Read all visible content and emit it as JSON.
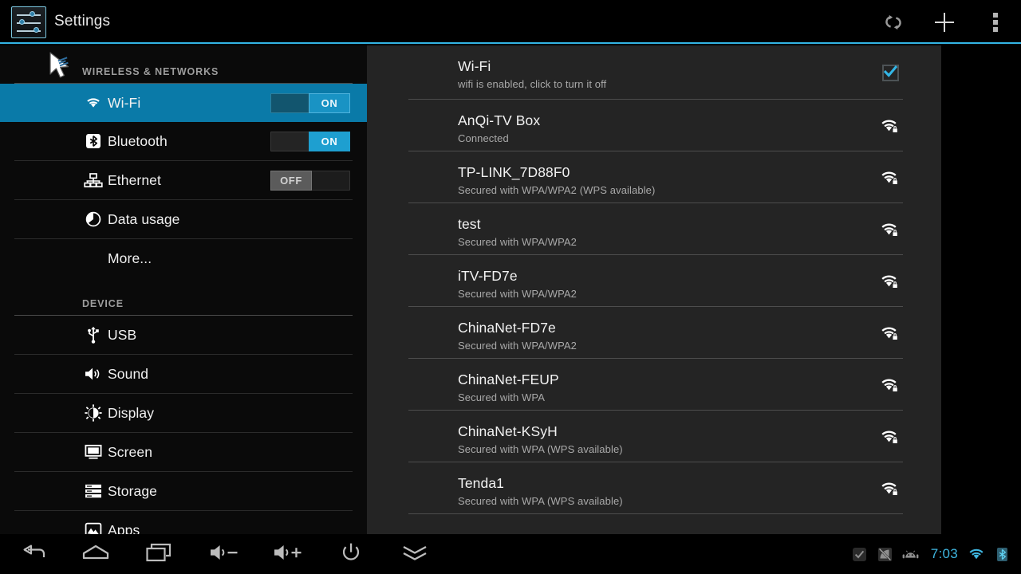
{
  "app": {
    "title": "Settings",
    "icon": "settings-sliders-icon",
    "accent": "#33b5e5",
    "panel_bg": "#242424",
    "sidebar_bg": "#0a0a0a",
    "selected_bg": "#0a7aa8"
  },
  "actionbar": {
    "buttons": [
      {
        "name": "scan-refresh-button",
        "icon": "sync-refresh-icon"
      },
      {
        "name": "add-network-button",
        "icon": "plus-icon"
      },
      {
        "name": "overflow-menu-button",
        "icon": "more-vertical-icon"
      }
    ]
  },
  "sidebar": {
    "groups": [
      {
        "header": "WIRELESS & NETWORKS",
        "items": [
          {
            "label": "Wi-Fi",
            "icon": "wifi-icon",
            "selected": true,
            "toggle": "ON",
            "toggle_state": "on"
          },
          {
            "label": "Bluetooth",
            "icon": "bluetooth-icon",
            "selected": false,
            "toggle": "ON",
            "toggle_state": "on"
          },
          {
            "label": "Ethernet",
            "icon": "ethernet-icon",
            "selected": false,
            "toggle": "OFF",
            "toggle_state": "off"
          },
          {
            "label": "Data usage",
            "icon": "data-usage-icon",
            "selected": false,
            "toggle": null
          },
          {
            "label": "More...",
            "icon": null,
            "selected": false,
            "toggle": null
          }
        ]
      },
      {
        "header": "DEVICE",
        "items": [
          {
            "label": "USB",
            "icon": "usb-icon",
            "selected": false,
            "toggle": null
          },
          {
            "label": "Sound",
            "icon": "sound-icon",
            "selected": false,
            "toggle": null
          },
          {
            "label": "Display",
            "icon": "display-brightness-icon",
            "selected": false,
            "toggle": null
          },
          {
            "label": "Screen",
            "icon": "screen-monitor-icon",
            "selected": false,
            "toggle": null
          },
          {
            "label": "Storage",
            "icon": "storage-icon",
            "selected": false,
            "toggle": null
          },
          {
            "label": "Apps",
            "icon": "apps-icon",
            "selected": false,
            "toggle": null
          }
        ]
      }
    ]
  },
  "wifi_panel": {
    "header": {
      "title": "Wi-Fi",
      "subtitle": "wifi is enabled, click to turn it off",
      "checkbox_checked": true,
      "checkbox_color": "#33b5e5"
    },
    "networks": [
      {
        "ssid": "AnQi-TV Box",
        "status": "Connected",
        "icon": "wifi-lock-icon"
      },
      {
        "ssid": "TP-LINK_7D88F0",
        "status": "Secured with WPA/WPA2 (WPS available)",
        "icon": "wifi-lock-icon"
      },
      {
        "ssid": "test",
        "status": "Secured with WPA/WPA2",
        "icon": "wifi-lock-icon"
      },
      {
        "ssid": "iTV-FD7e",
        "status": "Secured with WPA/WPA2",
        "icon": "wifi-lock-icon"
      },
      {
        "ssid": "ChinaNet-FD7e",
        "status": "Secured with WPA/WPA2",
        "icon": "wifi-lock-icon"
      },
      {
        "ssid": "ChinaNet-FEUP",
        "status": "Secured with WPA",
        "icon": "wifi-lock-icon"
      },
      {
        "ssid": "ChinaNet-KSyH",
        "status": "Secured with WPA (WPS available)",
        "icon": "wifi-lock-icon"
      },
      {
        "ssid": "Tenda1",
        "status": "Secured with WPA (WPS available)",
        "icon": "wifi-lock-icon"
      }
    ]
  },
  "navbar": {
    "buttons": [
      {
        "name": "back-button",
        "icon": "back-arrow-icon"
      },
      {
        "name": "home-button",
        "icon": "home-icon"
      },
      {
        "name": "recents-button",
        "icon": "recents-icon"
      },
      {
        "name": "volume-down-button",
        "icon": "volume-down-icon"
      },
      {
        "name": "volume-up-button",
        "icon": "volume-up-icon"
      },
      {
        "name": "power-button",
        "icon": "power-icon"
      },
      {
        "name": "hide-bar-button",
        "icon": "chevron-double-down-icon"
      }
    ],
    "tray": {
      "icons": [
        {
          "name": "checkmark-status-icon",
          "icon": "check-badge-icon"
        },
        {
          "name": "no-signal-status-icon",
          "icon": "signal-slash-icon"
        },
        {
          "name": "android-status-icon",
          "icon": "android-head-icon"
        }
      ],
      "clock": "7:03",
      "clock_color": "#3fb6e0",
      "wifi_icon": "wifi-signal-icon",
      "bluetooth_icon": "bluetooth-icon"
    }
  },
  "cursor": {
    "name": "mouse-pointer",
    "icon": "arrow-cursor-icon"
  }
}
